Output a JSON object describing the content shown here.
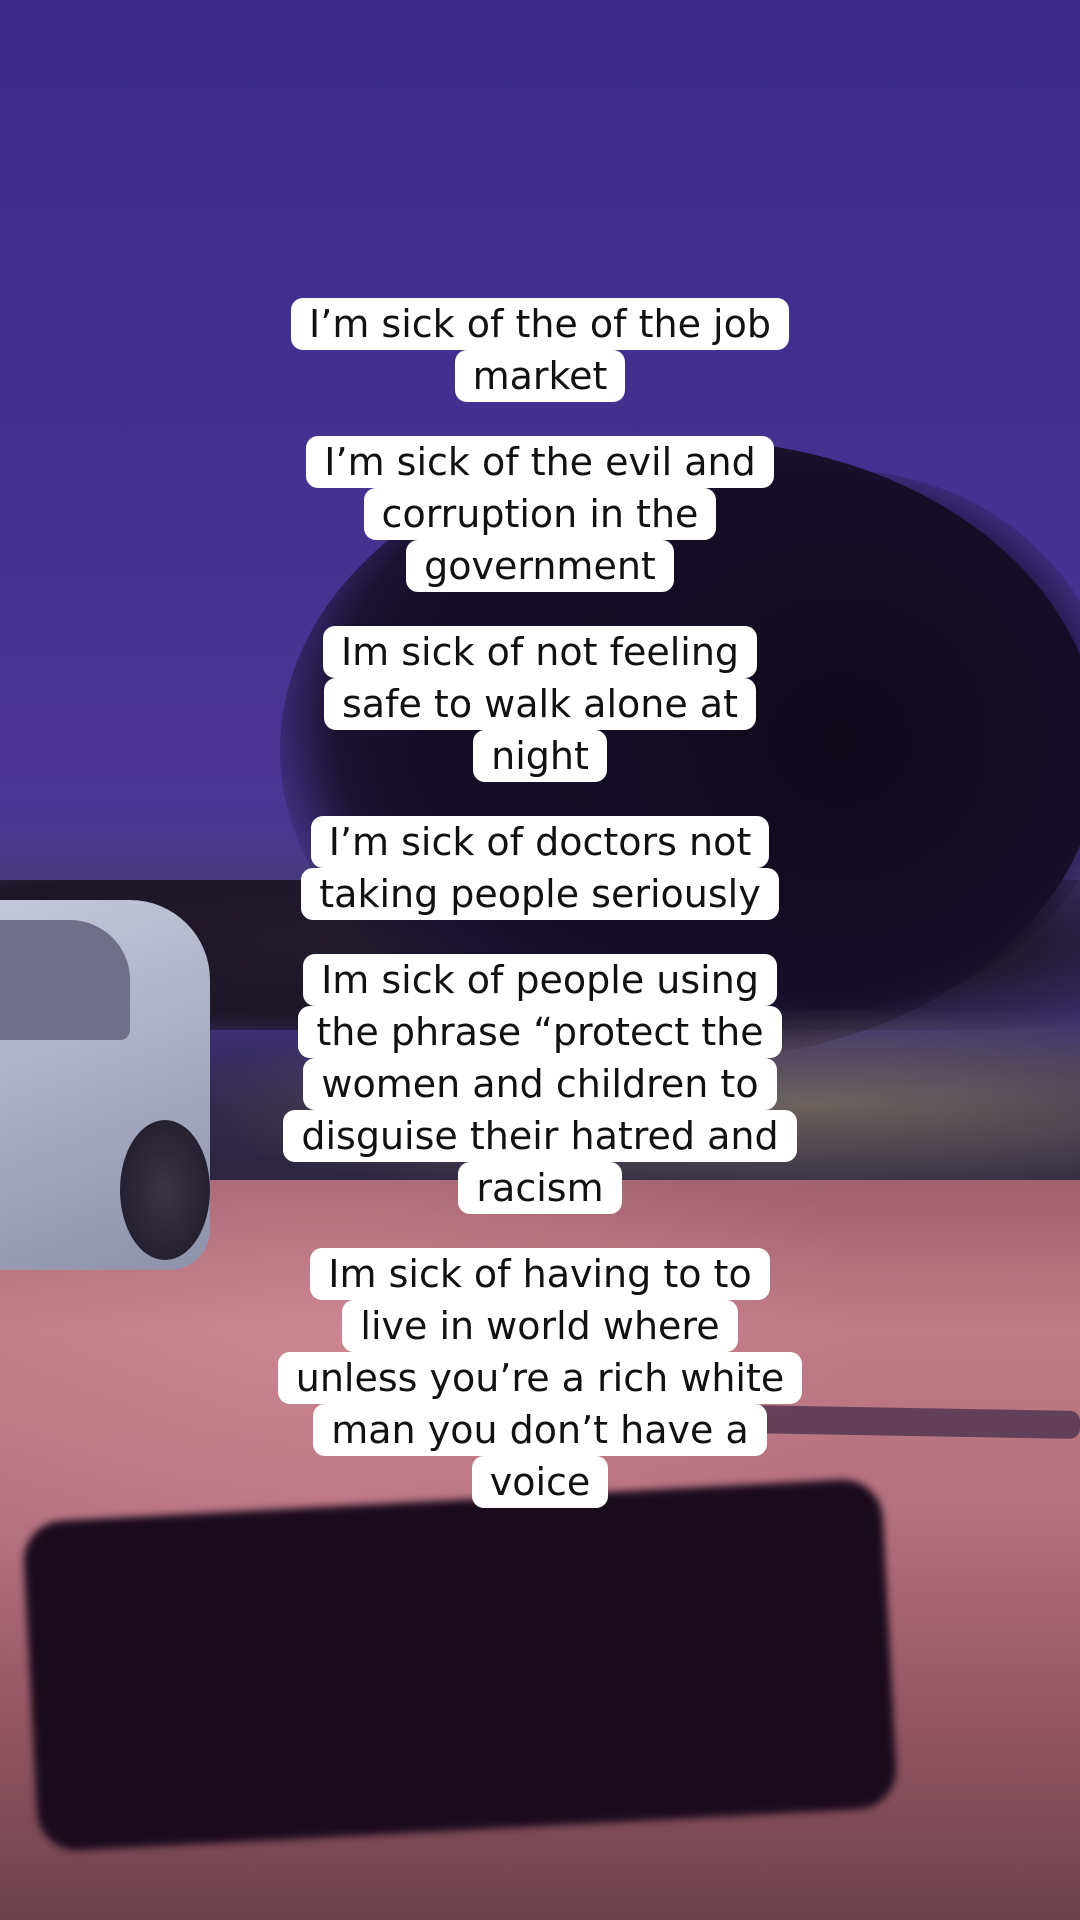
{
  "captions": [
    {
      "lines": [
        "I’m sick of the of the job",
        "market"
      ]
    },
    {
      "lines": [
        "I’m sick of the evil and",
        "corruption in the",
        "government"
      ]
    },
    {
      "lines": [
        "Im sick of not feeling",
        "safe to walk alone at",
        "night"
      ]
    },
    {
      "lines": [
        "I’m sick of doctors not",
        "taking people seriously"
      ]
    },
    {
      "lines": [
        "Im sick of people using",
        "the phrase “protect the",
        "women and children to",
        "disguise their hatred and",
        "racism"
      ]
    },
    {
      "lines": [
        "Im sick of having to to",
        "live in world where",
        "unless you’re a rich white",
        "man you don’t have a",
        "voice"
      ]
    }
  ]
}
